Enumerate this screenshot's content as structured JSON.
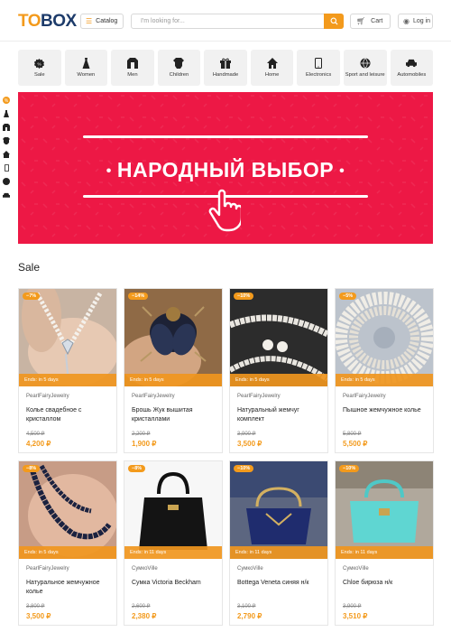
{
  "header": {
    "logo_to": "TO",
    "logo_box": "BOX",
    "catalog_label": "Catalog",
    "search_placeholder": "I'm looking for...",
    "cart_label": "Cart",
    "login_label": "Log in"
  },
  "categories": [
    {
      "label": "Sale",
      "icon": "sale-icon"
    },
    {
      "label": "Women",
      "icon": "dress-icon"
    },
    {
      "label": "Men",
      "icon": "jacket-icon"
    },
    {
      "label": "Children",
      "icon": "baby-bodysuit-icon"
    },
    {
      "label": "Handmade",
      "icon": "gift-icon"
    },
    {
      "label": "Home",
      "icon": "house-icon"
    },
    {
      "label": "Electronics",
      "icon": "phone-icon"
    },
    {
      "label": "Sport and leisure",
      "icon": "ball-icon"
    },
    {
      "label": "Automobiles",
      "icon": "car-icon"
    }
  ],
  "banner": {
    "title": "НАРОДНЫЙ ВЫБОР",
    "bg_color": "#ed1845"
  },
  "section_title": "Sale",
  "accent_color": "#f39a1c",
  "products": [
    {
      "discount": "−7%",
      "ends": "Ends: in 5 days",
      "seller": "PearlFairyJewelry",
      "name": "Колье свадебное с кристаллом",
      "old_price": "4,500 ₽",
      "price": "4,200 ₽"
    },
    {
      "discount": "−14%",
      "ends": "Ends: in 5 days",
      "seller": "PearlFairyJewelry",
      "name": "Брошь Жук вышитая кристаллами",
      "old_price": "2,200 ₽",
      "price": "1,900 ₽"
    },
    {
      "discount": "−10%",
      "ends": "Ends: in 5 days",
      "seller": "PearlFairyJewelry",
      "name": "Натуральный жемчуг комплект",
      "old_price": "3,900 ₽",
      "price": "3,500 ₽"
    },
    {
      "discount": "−5%",
      "ends": "Ends: in 5 days",
      "seller": "PearlFairyJewelry",
      "name": "Пышное жемчужное колье",
      "old_price": "5,800 ₽",
      "price": "5,500 ₽"
    },
    {
      "discount": "−8%",
      "ends": "Ends: in 5 days",
      "seller": "PearlFairyJewelry",
      "name": "Натуральное жемчужное колье",
      "old_price": "3,800 ₽",
      "price": "3,500 ₽"
    },
    {
      "discount": "−8%",
      "ends": "Ends: in 11 days",
      "seller": "СумкоVille",
      "name": "Сумка Victoria Beckham",
      "old_price": "2,600 ₽",
      "price": "2,380 ₽"
    },
    {
      "discount": "−10%",
      "ends": "Ends: in 11 days",
      "seller": "СумкоVille",
      "name": "Bottega Veneta синяя н/к",
      "old_price": "3,100 ₽",
      "price": "2,790 ₽"
    },
    {
      "discount": "−10%",
      "ends": "Ends: in 11 days",
      "seller": "СумкоVille",
      "name": "Chloe бирюза н/к",
      "old_price": "3,900 ₽",
      "price": "3,510 ₽"
    }
  ]
}
